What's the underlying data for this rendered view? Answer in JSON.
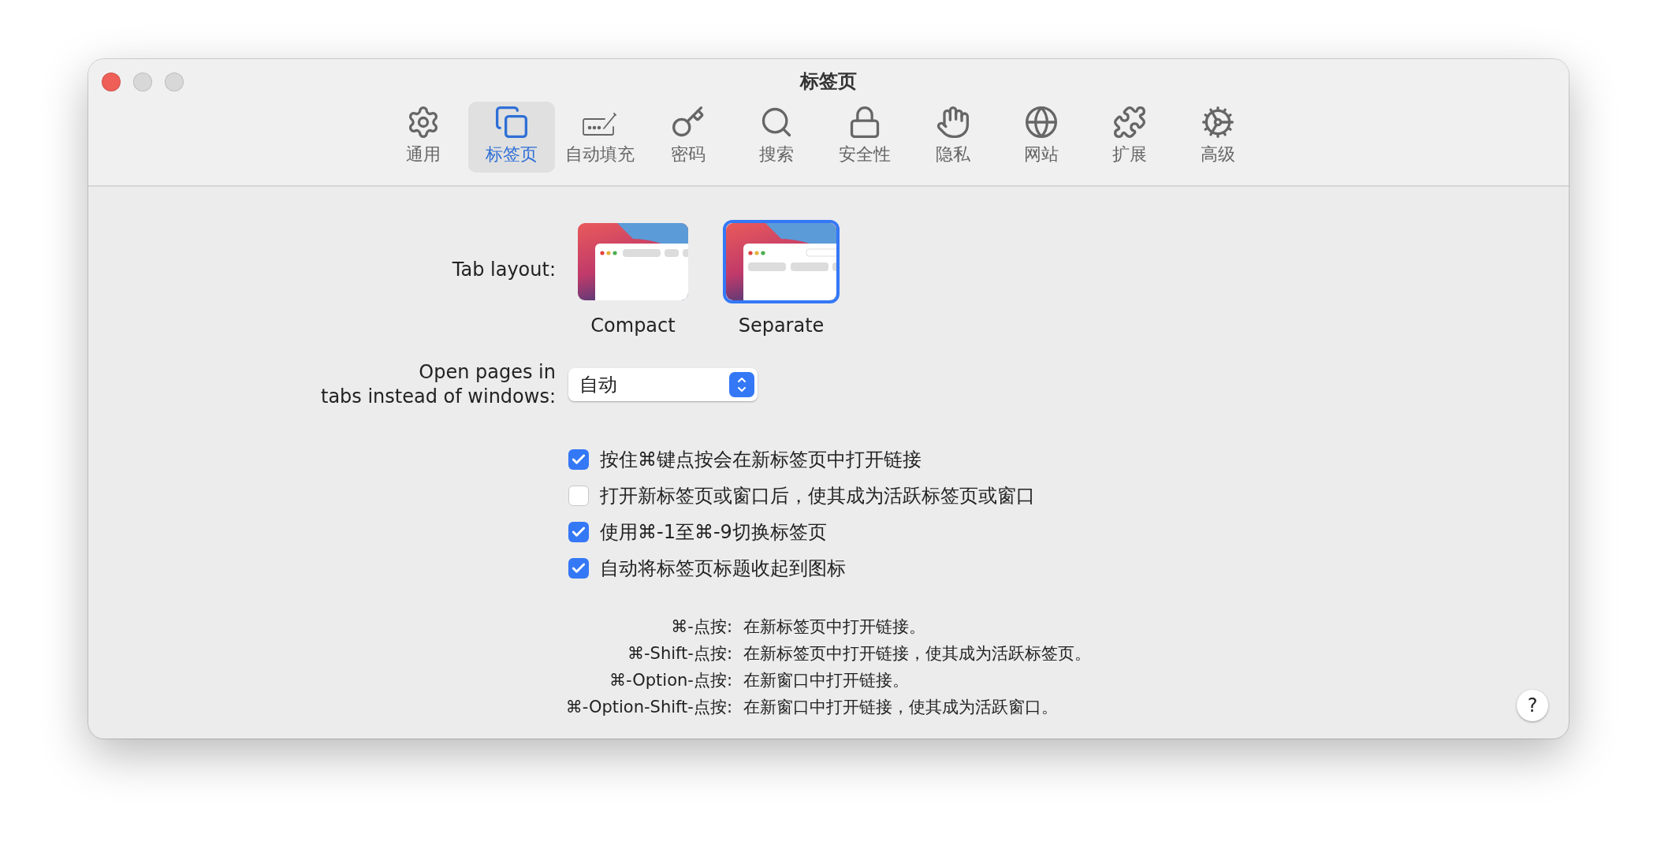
{
  "window": {
    "title": "标签页"
  },
  "toolbar": [
    {
      "label": "通用",
      "selected": false
    },
    {
      "label": "标签页",
      "selected": true
    },
    {
      "label": "自动填充",
      "selected": false
    },
    {
      "label": "密码",
      "selected": false
    },
    {
      "label": "搜索",
      "selected": false
    },
    {
      "label": "安全性",
      "selected": false
    },
    {
      "label": "隐私",
      "selected": false
    },
    {
      "label": "网站",
      "selected": false
    },
    {
      "label": "扩展",
      "selected": false
    },
    {
      "label": "高级",
      "selected": false
    }
  ],
  "tab_layout": {
    "label": "Tab layout:",
    "options": [
      {
        "kind": "compact",
        "label": "Compact",
        "selected": false
      },
      {
        "kind": "separate",
        "label": "Separate",
        "selected": true
      }
    ]
  },
  "open_pages": {
    "label": "Open pages in\ntabs instead of windows:",
    "value": "自动"
  },
  "checkboxes": [
    {
      "label": "按住⌘键点按会在新标签页中打开链接",
      "checked": true
    },
    {
      "label": "打开新标签页或窗口后，使其成为活跃标签页或窗口",
      "checked": false
    },
    {
      "label": "使用⌘-1至⌘-9切换标签页",
      "checked": true
    },
    {
      "label": "自动将标签页标题收起到图标",
      "checked": true
    }
  ],
  "shortcuts": [
    {
      "keys": "⌘-点按:",
      "description": "在新标签页中打开链接。"
    },
    {
      "keys": "⌘-Shift-点按:",
      "description": "在新标签页中打开链接，使其成为活跃标签页。"
    },
    {
      "keys": "⌘-Option-点按:",
      "description": "在新窗口中打开链接。"
    },
    {
      "keys": "⌘-Option-Shift-点按:",
      "description": "在新窗口中打开链接，使其成为活跃窗口。"
    }
  ],
  "help_button": {
    "label": "?"
  }
}
